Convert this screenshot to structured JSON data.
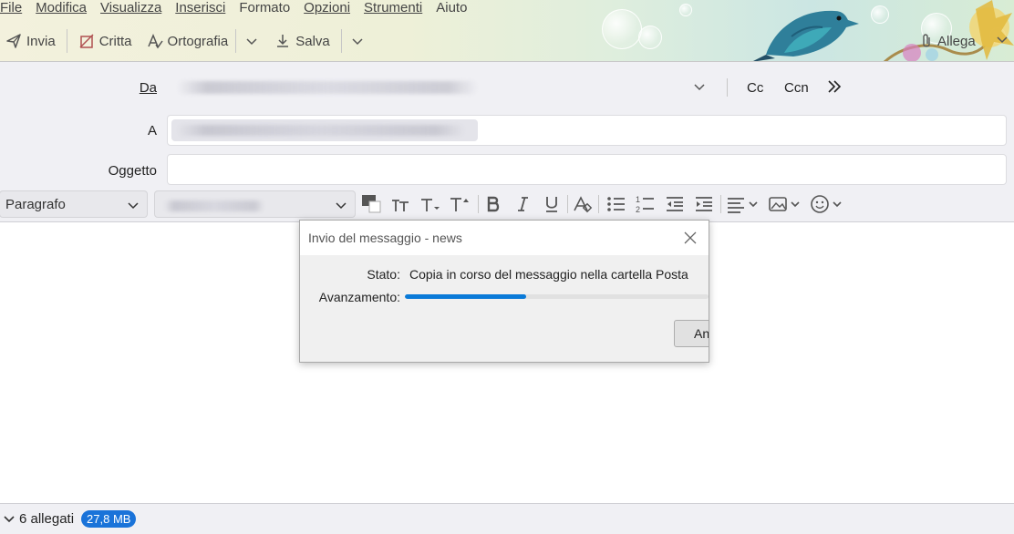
{
  "menu": [
    {
      "label": "File"
    },
    {
      "label": "Modifica"
    },
    {
      "label": "Visualizza"
    },
    {
      "label": "Inserisci"
    },
    {
      "label": "Formato"
    },
    {
      "label": "Opzioni"
    },
    {
      "label": "Strumenti"
    },
    {
      "label": "Aiuto"
    }
  ],
  "toolbar": {
    "send_label": "Invia",
    "encrypt_label": "Critta",
    "spelling_label": "Ortografia",
    "save_label": "Salva",
    "attach_label": "Allega"
  },
  "compose": {
    "from_label": "Da",
    "to_label": "A",
    "subject_label": "Oggetto",
    "subject_value": "",
    "cc_label": "Cc",
    "bcc_label": "Ccn"
  },
  "format": {
    "paragraph_select": "Paragrafo"
  },
  "dialog": {
    "title": "Invio del messaggio - news",
    "status_label": "Stato:",
    "status_value": "Copia in corso del messaggio nella cartella Posta",
    "progress_label": "Avanzamento:",
    "progress_fraction": 0.4,
    "button_label": "Annulla"
  },
  "statusbar": {
    "attachments_label": "6 allegati",
    "size_badge": "27,8 MB"
  },
  "colors": {
    "accent": "#0a7ad8",
    "badge": "#1a73d9"
  }
}
